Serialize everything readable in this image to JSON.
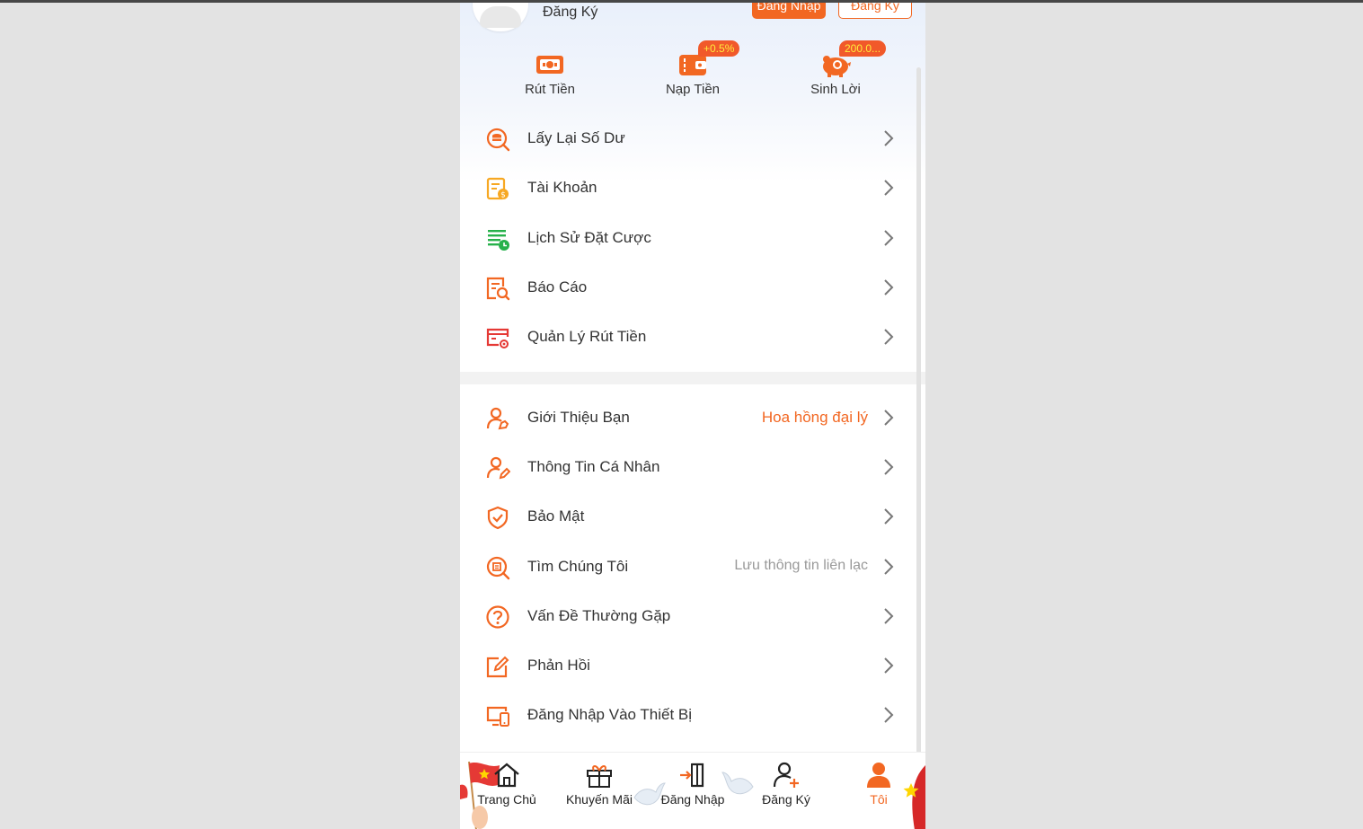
{
  "colors": {
    "accent": "#f26722",
    "badge_bg": "#f1592a",
    "badge_text": "#ffeb3b",
    "green": "#27b14b",
    "red": "#e53935"
  },
  "header": {
    "user_label": "Đăng Ký",
    "login_button": "Đăng Nhập",
    "register_button": "Đăng Ký"
  },
  "quick_actions": [
    {
      "label": "Rút Tiền",
      "icon": "withdraw-icon"
    },
    {
      "label": "Nạp Tiền",
      "icon": "wallet-icon",
      "badge": "+0.5%"
    },
    {
      "label": "Sinh Lời",
      "icon": "piggy-bank-icon",
      "badge": "200.0..."
    }
  ],
  "menu_group_1": [
    {
      "label": "Lấy Lại Số Dư",
      "icon": "coin-search-icon"
    },
    {
      "label": "Tài Khoản",
      "icon": "account-card-icon"
    },
    {
      "label": "Lịch Sử Đặt Cược",
      "icon": "bet-history-icon"
    },
    {
      "label": "Báo Cáo",
      "icon": "report-icon"
    },
    {
      "label": "Quản Lý Rút Tiền",
      "icon": "withdraw-manage-icon"
    }
  ],
  "menu_group_2": [
    {
      "label": "Giới Thiệu Bạn",
      "icon": "refer-friend-icon",
      "hint": "Hoa hồng đại lý"
    },
    {
      "label": "Thông Tin Cá Nhân",
      "icon": "profile-edit-icon"
    },
    {
      "label": "Bảo Mật",
      "icon": "shield-check-icon"
    },
    {
      "label": "Tìm Chúng Tôi",
      "icon": "find-us-icon",
      "hint": "Lưu thông tin liên lạc"
    },
    {
      "label": "Vấn Đề Thường Gặp",
      "icon": "question-icon"
    },
    {
      "label": "Phản Hồi",
      "icon": "feedback-icon"
    },
    {
      "label": "Đăng Nhập Vào Thiết Bị",
      "icon": "devices-icon"
    }
  ],
  "tabbar": [
    {
      "label": "Trang Chủ",
      "icon": "home-icon"
    },
    {
      "label": "Khuyến Mãi",
      "icon": "gift-icon"
    },
    {
      "label": "Đăng Nhập",
      "icon": "login-door-icon"
    },
    {
      "label": "Đăng Ký",
      "icon": "add-user-icon"
    },
    {
      "label": "Tôi",
      "icon": "person-icon",
      "active": true
    }
  ]
}
